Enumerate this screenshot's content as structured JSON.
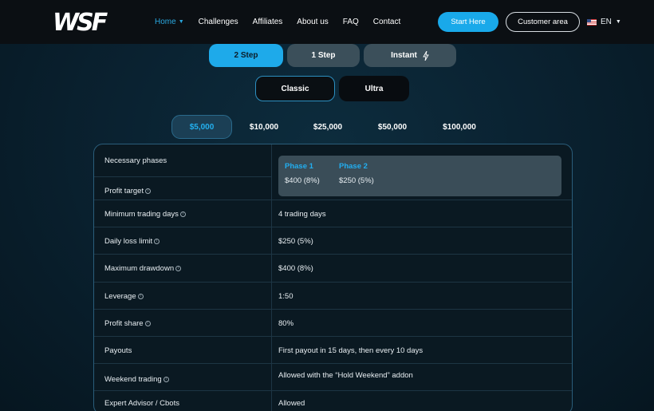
{
  "nav": {
    "logo_text": "WSF",
    "links": [
      {
        "label": "Home",
        "active": true
      },
      {
        "label": "Challenges"
      },
      {
        "label": "Affiliates"
      },
      {
        "label": "About us"
      },
      {
        "label": "FAQ"
      },
      {
        "label": "Contact"
      }
    ],
    "start_label": "Start Here",
    "customer_label": "Customer area",
    "language": "EN"
  },
  "step_tabs": [
    {
      "label": "2 Step",
      "active": true
    },
    {
      "label": "1 Step"
    },
    {
      "label": "Instant"
    }
  ],
  "type_tabs": [
    {
      "label": "Classic",
      "active": true
    },
    {
      "label": "Ultra"
    }
  ],
  "amounts": [
    {
      "label": "$5,000",
      "active": true
    },
    {
      "label": "$10,000"
    },
    {
      "label": "$25,000"
    },
    {
      "label": "$50,000"
    },
    {
      "label": "$100,000"
    }
  ],
  "table": {
    "necessary_phases_label": "Necessary phases",
    "profit_target_label": "Profit target",
    "phases": [
      {
        "name": "Phase 1",
        "value": "$400 (8%)"
      },
      {
        "name": "Phase 2",
        "value": "$250 (5%)"
      }
    ],
    "rows": [
      {
        "label": "Minimum trading days",
        "value": "4 trading days"
      },
      {
        "label": "Daily loss limit",
        "value": "$250 (5%)"
      },
      {
        "label": "Maximum drawdown",
        "value": "$400 (8%)"
      },
      {
        "label": "Leverage",
        "value": "1:50"
      },
      {
        "label": "Profit share",
        "value": "80%"
      },
      {
        "label": "Payouts",
        "value": "First payout in 15 days, then every 10 days"
      },
      {
        "label": "Weekend trading",
        "value": "Allowed with the “Hold Weekend” addon"
      },
      {
        "label": "Expert Advisor / Cbots",
        "value": "Allowed"
      }
    ]
  },
  "colors": {
    "accent": "#1eaaea",
    "background": "#0a2231",
    "nav_background": "#0b0f13"
  }
}
